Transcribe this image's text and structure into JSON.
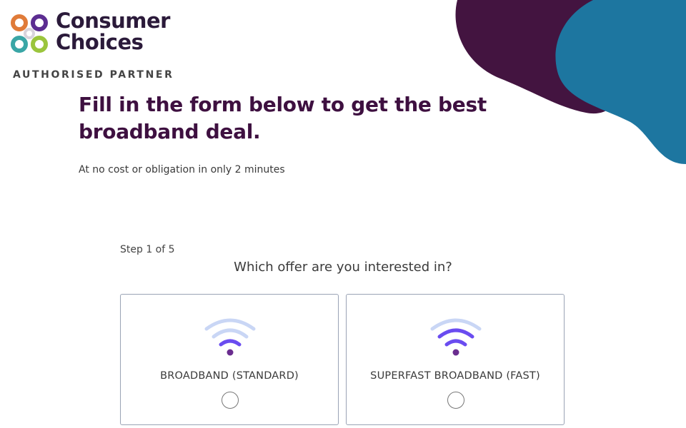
{
  "brand": {
    "name_line1": "Consumer",
    "name_line2": "Choices",
    "tagline": "AUTHORISED PARTNER",
    "logo_icon": "four-ring-logo-icon",
    "colors": {
      "headline": "#3e1040",
      "blob_dark": "#431440",
      "blob_blue": "#1d76a0",
      "ring_orange": "#e07b39",
      "ring_purple": "#5c2d91",
      "ring_teal": "#3aa6a6",
      "ring_green": "#9bc53d"
    }
  },
  "hero": {
    "headline": "Fill in the form below to get the best broadband deal.",
    "subline": "At no cost or obligation in only 2 minutes"
  },
  "form": {
    "step": "Step 1 of 5",
    "question": "Which offer are you interested in?",
    "options": [
      {
        "label": "BROADBAND (STANDARD)",
        "icon": "wifi-icon",
        "selected": false,
        "signal_bars_active": 1
      },
      {
        "label": "SUPERFAST BROADBAND (FAST)",
        "icon": "wifi-icon",
        "selected": false,
        "signal_bars_active": 2
      }
    ]
  }
}
